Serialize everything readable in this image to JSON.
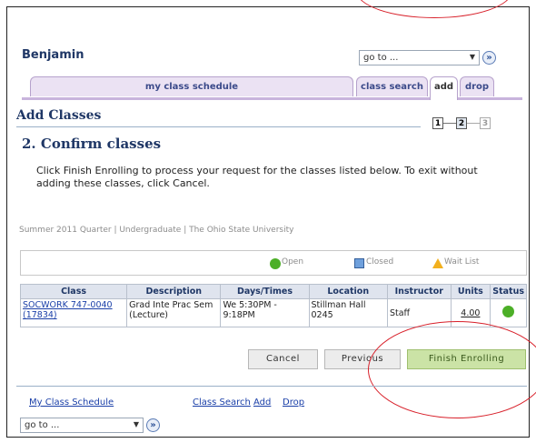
{
  "header": {
    "student_name": "Benjamin",
    "goto_value": "go to ...",
    "go_symbol": "»"
  },
  "tabs": {
    "my_class_schedule": "my class schedule",
    "class_search": "class search",
    "add": "add",
    "drop": "drop"
  },
  "page": {
    "title": "Add Classes",
    "steps": [
      "1",
      "2",
      "3"
    ],
    "current_step": 2,
    "subtitle": "2.  Confirm classes",
    "instructions": "Click Finish Enrolling to process your request for the classes listed below. To exit without adding these classes, click Cancel.",
    "term_info": "Summer 2011 Quarter | Undergraduate | The Ohio State University"
  },
  "legend": {
    "open": "Open",
    "closed": "Closed",
    "wait_list": "Wait List"
  },
  "table": {
    "headers": [
      "Class",
      "Description",
      "Days/Times",
      "Location",
      "Instructor",
      "Units",
      "Status"
    ],
    "rows": [
      {
        "class_line1": "SOCWORK 747-0040",
        "class_line2": "(17834)",
        "description_line1": "Grad Inte Prac Sem",
        "description_line2": "(Lecture)",
        "days_line1": "We 5:30PM -",
        "days_line2": "9:18PM",
        "location_line1": "Stillman Hall",
        "location_line2": "0245",
        "instructor": "Staff",
        "units": "4.00",
        "status": "Open"
      }
    ]
  },
  "buttons": {
    "cancel": "Cancel",
    "previous": "Previous",
    "finish": "Finish Enrolling"
  },
  "footer_links": {
    "my_class_schedule": "My Class Schedule",
    "class_search": "Class Search",
    "add": "Add",
    "drop": "Drop"
  },
  "colors": {
    "open_status": "#4caf27",
    "finish_button": "#cbe3a6",
    "annotation": "#d8202a",
    "heading": "#1f3766"
  }
}
